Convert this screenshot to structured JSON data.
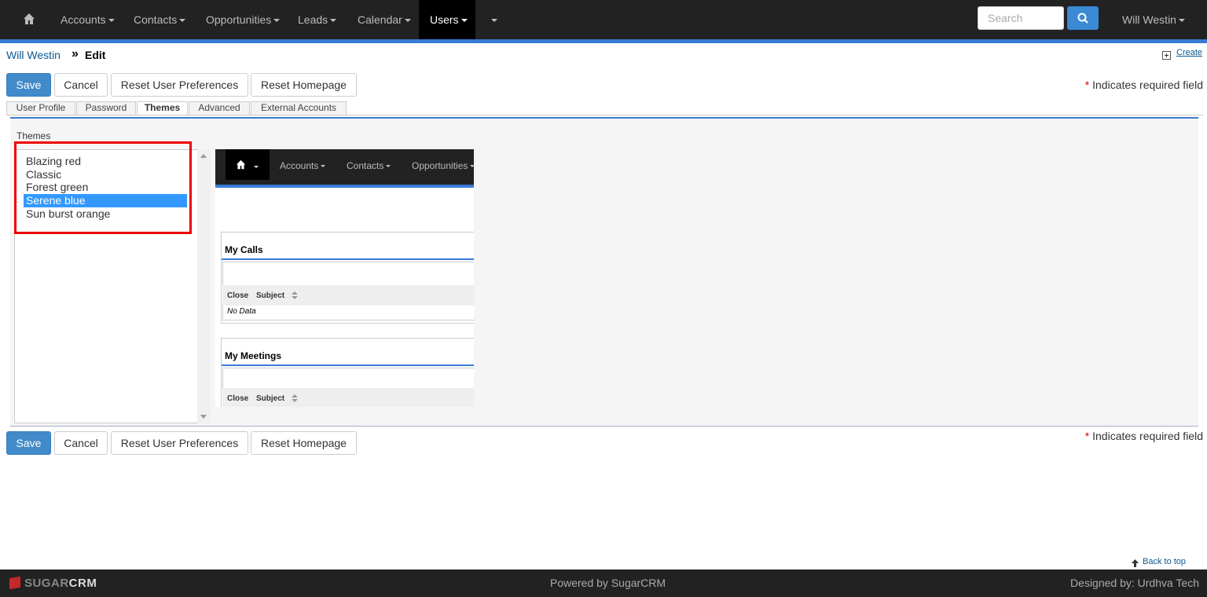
{
  "nav": {
    "items": [
      {
        "label": "Accounts"
      },
      {
        "label": "Contacts"
      },
      {
        "label": "Opportunities"
      },
      {
        "label": "Leads"
      },
      {
        "label": "Calendar"
      },
      {
        "label": "Users"
      }
    ],
    "active": "Users",
    "search_placeholder": "Search",
    "user_menu": "Will Westin"
  },
  "breadcrumb": {
    "user": "Will Westin",
    "separator": "»",
    "page": "Edit"
  },
  "actions": {
    "create": "Create"
  },
  "buttons": {
    "save": "Save",
    "cancel": "Cancel",
    "reset_prefs": "Reset User Preferences",
    "reset_home": "Reset Homepage"
  },
  "required_note": {
    "star": "*",
    "text": "Indicates required field"
  },
  "tabs": [
    {
      "label": "User Profile"
    },
    {
      "label": "Password"
    },
    {
      "label": "Themes"
    },
    {
      "label": "Advanced"
    },
    {
      "label": "External Accounts"
    }
  ],
  "active_tab": "Themes",
  "themes": {
    "label": "Themes",
    "options": [
      "Blazing red",
      "Classic",
      "Forest green",
      "Serene blue",
      "Sun burst orange"
    ],
    "selected": "Serene blue"
  },
  "preview": {
    "nav_items": [
      "Accounts",
      "Contacts",
      "Opportunities"
    ],
    "dashlets": [
      {
        "title": "My Calls",
        "columns": [
          "Close",
          "Subject"
        ],
        "empty": "No Data"
      },
      {
        "title": "My Meetings",
        "columns": [
          "Close",
          "Subject"
        ]
      }
    ]
  },
  "footer": {
    "back_to_top": "Back to top",
    "logo_sugar": "SUGAR",
    "logo_crm": "CRM",
    "powered": "Powered by SugarCRM",
    "designed": "Designed by: Urdhva Tech"
  },
  "colors": {
    "accent": "#3a7bd5",
    "primary_button": "#428bca",
    "selection": "#3399ff",
    "highlight": "#e00000",
    "navbar": "#222222"
  }
}
